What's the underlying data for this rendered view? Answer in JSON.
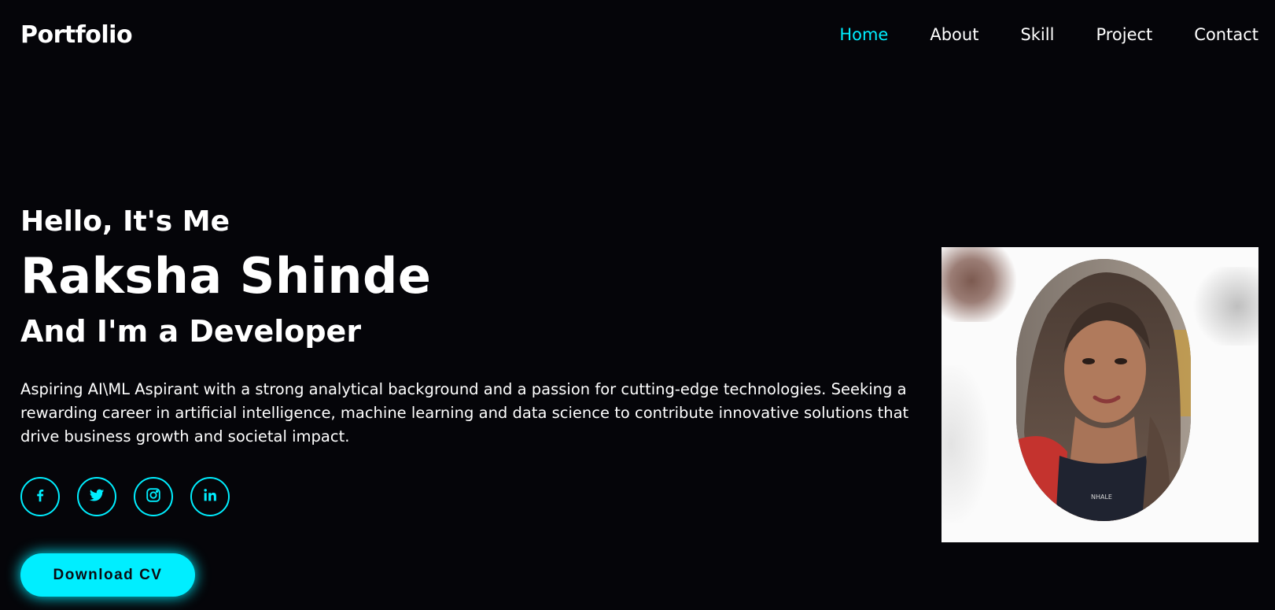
{
  "header": {
    "logo": "Portfolio",
    "nav": [
      {
        "label": "Home",
        "active": true
      },
      {
        "label": "About",
        "active": false
      },
      {
        "label": "Skill",
        "active": false
      },
      {
        "label": "Project",
        "active": false
      },
      {
        "label": "Contact",
        "active": false
      }
    ]
  },
  "hero": {
    "greeting": "Hello, It's Me",
    "name": "Raksha Shinde",
    "role": "And I'm a Developer",
    "description": "Aspiring AI\\ML Aspirant with a strong analytical background and a passion for cutting-edge technologies. Seeking a rewarding career in artificial intelligence, machine learning and data science to contribute innovative solutions that drive business growth and societal impact.",
    "socials": [
      {
        "icon": "facebook-icon"
      },
      {
        "icon": "twitter-icon"
      },
      {
        "icon": "instagram-icon"
      },
      {
        "icon": "linkedin-icon"
      }
    ],
    "cv_button": "Download CV"
  },
  "colors": {
    "background": "#050509",
    "accent": "#00eeff",
    "text": "#ffffff"
  },
  "photo": {
    "icon": "profile-photo"
  }
}
